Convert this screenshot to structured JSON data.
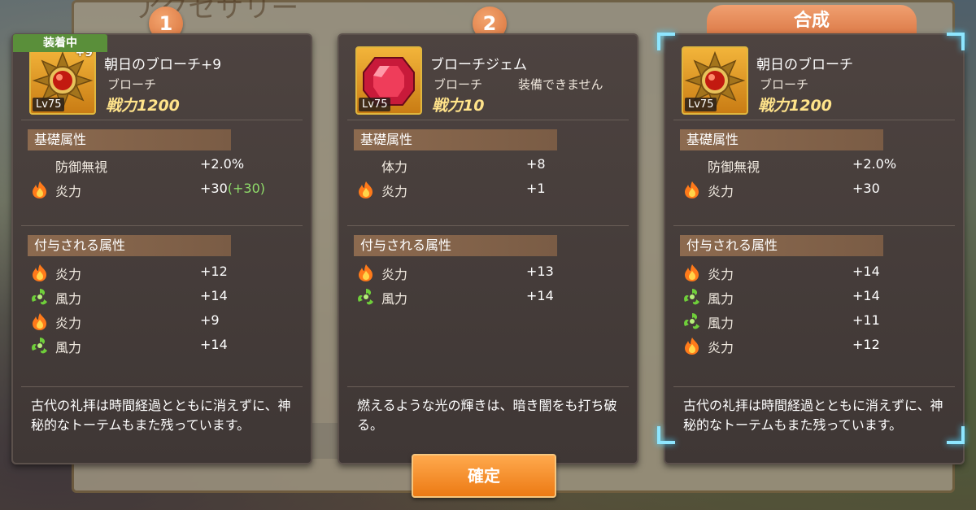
{
  "background": {
    "title_fragment": "アクセサリー",
    "button_fragment": "合成"
  },
  "badges": {
    "slot1": "1",
    "slot2": "2",
    "synth_tab": "合成"
  },
  "equipped_tag": "装着中",
  "panels": [
    {
      "name": "朝日のブローチ+9",
      "plus": "+9",
      "level": "Lv75",
      "type": "ブローチ",
      "note": "",
      "power": "戦力1200",
      "base_header": "基礎属性",
      "base": [
        {
          "icon": "none",
          "label": "防御無視",
          "value": "+2.0%",
          "bonus": ""
        },
        {
          "icon": "fire-icon",
          "label": "炎力",
          "value": "+30",
          "bonus": "(+30)"
        }
      ],
      "granted_header": "付与される属性",
      "granted": [
        {
          "icon": "fire-icon",
          "label": "炎力",
          "value": "+12"
        },
        {
          "icon": "wind-icon",
          "label": "風力",
          "value": "+14"
        },
        {
          "icon": "fire-icon",
          "label": "炎力",
          "value": "+9"
        },
        {
          "icon": "wind-icon",
          "label": "風力",
          "value": "+14"
        }
      ],
      "description": "古代の礼拝は時間経過とともに消えずに、神秘的なトーテムもまた残っています。"
    },
    {
      "name": "ブローチジェム",
      "level": "Lv75",
      "type": "ブローチ",
      "note": "装備できません",
      "power": "戦力10",
      "base_header": "基礎属性",
      "base": [
        {
          "icon": "none",
          "label": "体力",
          "value": "+8"
        },
        {
          "icon": "fire-icon",
          "label": "炎力",
          "value": "+1"
        }
      ],
      "granted_header": "付与される属性",
      "granted": [
        {
          "icon": "fire-icon",
          "label": "炎力",
          "value": "+13"
        },
        {
          "icon": "wind-icon",
          "label": "風力",
          "value": "+14"
        }
      ],
      "description": "燃えるような光の輝きは、暗き闇をも打ち破る。"
    },
    {
      "name": "朝日のブローチ",
      "level": "Lv75",
      "type": "ブローチ",
      "note": "",
      "power": "戦力1200",
      "base_header": "基礎属性",
      "base": [
        {
          "icon": "none",
          "label": "防御無視",
          "value": "+2.0%"
        },
        {
          "icon": "fire-icon",
          "label": "炎力",
          "value": "+30"
        }
      ],
      "granted_header": "付与される属性",
      "granted": [
        {
          "icon": "fire-icon",
          "label": "炎力",
          "value": "+14"
        },
        {
          "icon": "wind-icon",
          "label": "風力",
          "value": "+14"
        },
        {
          "icon": "wind-icon",
          "label": "風力",
          "value": "+11"
        },
        {
          "icon": "fire-icon",
          "label": "炎力",
          "value": "+12"
        }
      ],
      "description": "古代の礼拝は時間経過とともに消えずに、神秘的なトーテムもまた残っています。"
    }
  ],
  "confirm_button": "確定",
  "colors": {
    "accent_orange": "#ec7a14",
    "power_yellow": "#ffe38a",
    "bonus_green": "#8fdc6a",
    "frame_cyan": "#8ee6ff"
  }
}
